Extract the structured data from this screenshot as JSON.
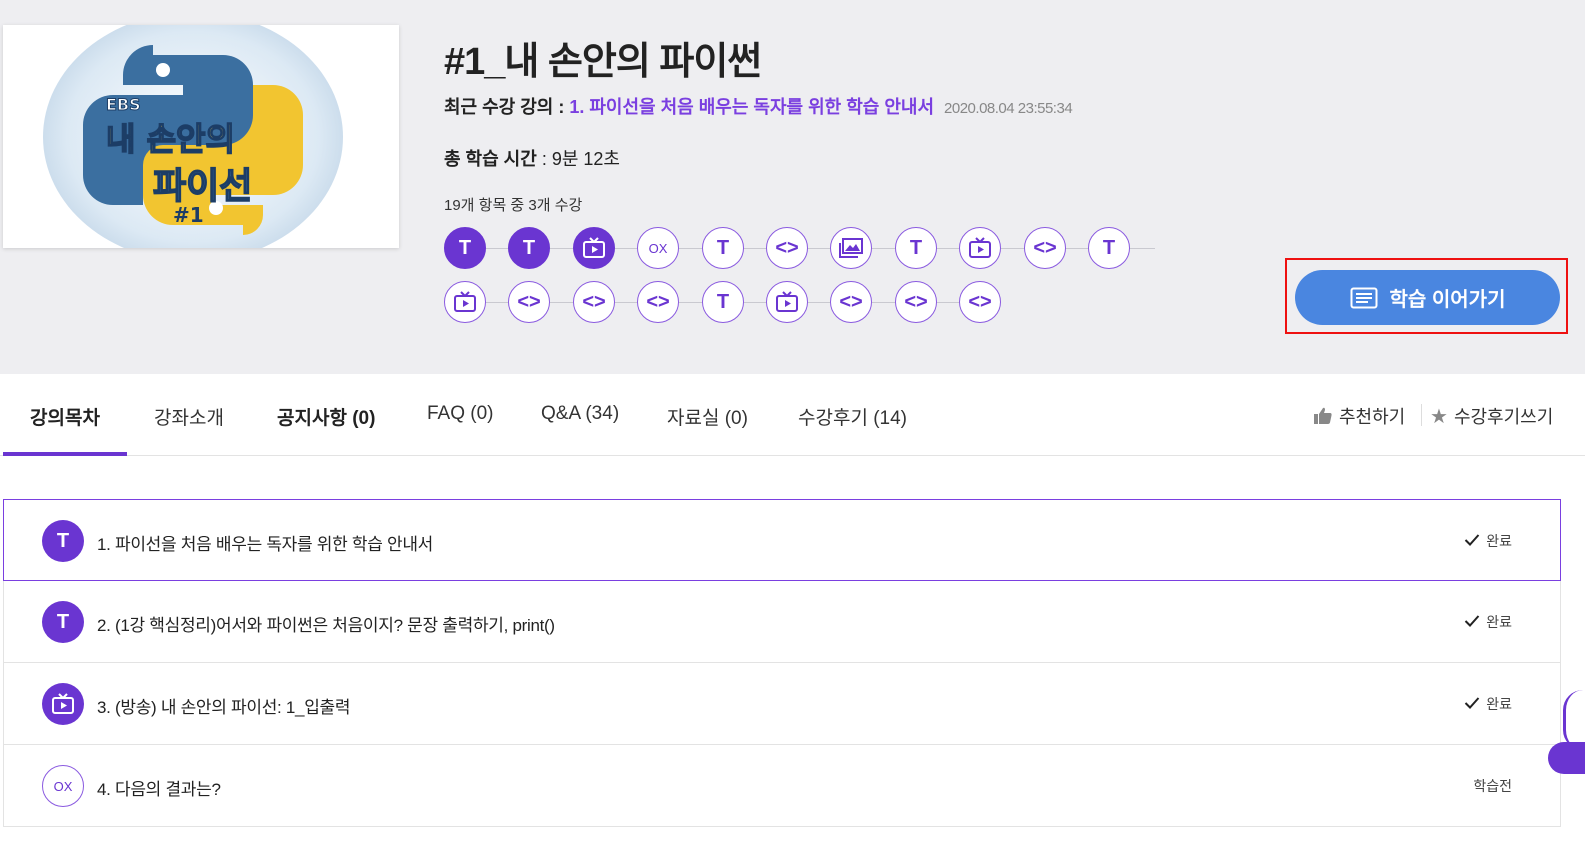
{
  "course": {
    "title": "#1_내 손안의 파이썬",
    "thumbnail_lines": [
      "EBS",
      "내 손안의",
      "파이선",
      "#1"
    ],
    "recent_label": "최근 수강 강의 : ",
    "recent_value": "1. 파이선을 처음 배우는 독자를 위한 학습 안내서",
    "recent_date": "2020.08.04 23:55:34",
    "total_label": "총 학습 시간",
    "total_value": " : 9분 12초",
    "progress_text": "19개 항목 중 3개 수강",
    "continue_label": "학습 이어가기"
  },
  "track_row1": [
    {
      "type": "text",
      "glyph": "T",
      "done": true
    },
    {
      "type": "text",
      "glyph": "T",
      "done": true
    },
    {
      "type": "video",
      "glyph": "tv-icon",
      "done": true
    },
    {
      "type": "quiz",
      "glyph": "OX",
      "done": false
    },
    {
      "type": "text",
      "glyph": "T",
      "done": false
    },
    {
      "type": "code",
      "glyph": "<>",
      "done": false
    },
    {
      "type": "image",
      "glyph": "gallery-icon",
      "done": false
    },
    {
      "type": "text",
      "glyph": "T",
      "done": false
    },
    {
      "type": "video",
      "glyph": "tv-icon",
      "done": false
    },
    {
      "type": "code",
      "glyph": "<>",
      "done": false
    },
    {
      "type": "text",
      "glyph": "T",
      "done": false
    }
  ],
  "track_row2": [
    {
      "type": "video",
      "glyph": "tv-icon",
      "done": false
    },
    {
      "type": "code",
      "glyph": "<>",
      "done": false
    },
    {
      "type": "code",
      "glyph": "<>",
      "done": false
    },
    {
      "type": "code",
      "glyph": "<>",
      "done": false
    },
    {
      "type": "text",
      "glyph": "T",
      "done": false
    },
    {
      "type": "video",
      "glyph": "tv-icon",
      "done": false
    },
    {
      "type": "code",
      "glyph": "<>",
      "done": false
    },
    {
      "type": "code",
      "glyph": "<>",
      "done": false
    },
    {
      "type": "code",
      "glyph": "<>",
      "done": false
    }
  ],
  "tabs": [
    {
      "label": "강의목차",
      "active": true
    },
    {
      "label": "강좌소개",
      "active": false
    },
    {
      "label": "공지사항 (0)",
      "active": false
    },
    {
      "label": "FAQ (0)",
      "active": false
    },
    {
      "label": "Q&A (34)",
      "active": false
    },
    {
      "label": "자료실 (0)",
      "active": false
    },
    {
      "label": "수강후기 (14)",
      "active": false
    }
  ],
  "actions": {
    "recommend": "추천하기",
    "review": "수강후기쓰기"
  },
  "lectures": [
    {
      "icon": "T",
      "type": "text",
      "title": "1. 파이선을 처음 배우는 독자를 위한 학습 안내서",
      "status": "완료"
    },
    {
      "icon": "T",
      "type": "text",
      "title": "2. (1강 핵심정리)어서와 파이썬은 처음이지? 문장 출력하기, print()",
      "status": "완료"
    },
    {
      "icon": "tv-icon",
      "type": "video",
      "title": "3. (방송) 내 손안의 파이선: 1_입출력",
      "status": "완료"
    },
    {
      "icon": "OX",
      "type": "quiz",
      "title": "4. 다음의 결과는?",
      "status": "학습전"
    }
  ],
  "colors": {
    "accent": "#6a35d1",
    "continue_button": "#4a86e0",
    "highlight": "#e11111",
    "hero_bg": "#eeeef1"
  }
}
